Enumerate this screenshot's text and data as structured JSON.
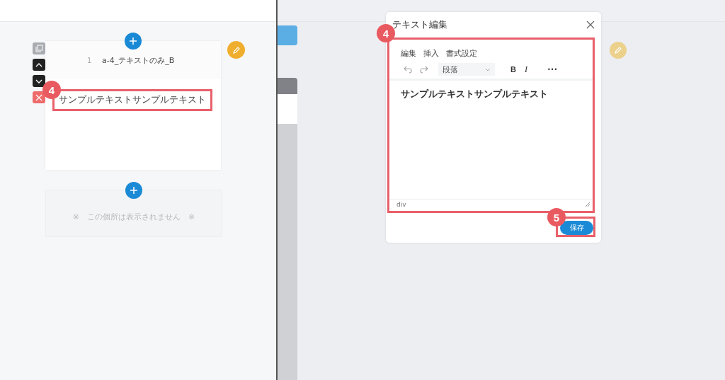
{
  "left_panel": {
    "block": {
      "number": "1",
      "title": "a-4_テキストのみ_B",
      "body": "サンプルテキストサンプルテキスト"
    },
    "hidden_block": {
      "notice": "※　この個所は表示されません　※"
    }
  },
  "dialog": {
    "title": "テキスト編集",
    "menu": [
      "編集",
      "挿入",
      "書式設定"
    ],
    "format_select": {
      "value": "段落"
    },
    "bold": "B",
    "italic": "I",
    "more": "•••",
    "content": "サンプルテキストサンプルテキスト",
    "path": "div",
    "save_button": "保存"
  },
  "annotations": [
    {
      "label": "4"
    },
    {
      "label": "4"
    },
    {
      "label": "5"
    }
  ]
}
